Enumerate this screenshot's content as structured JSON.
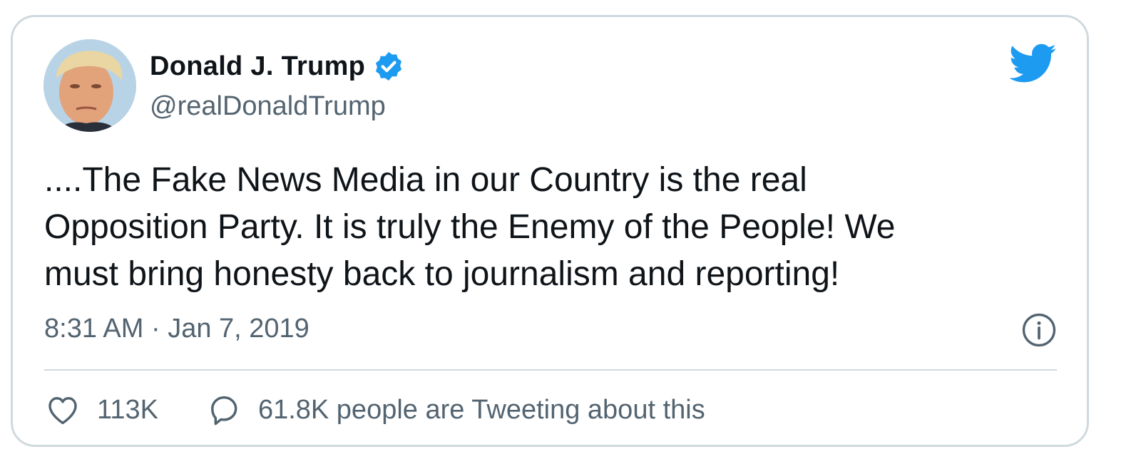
{
  "author": {
    "name": "Donald J. Trump",
    "handle": "@realDonaldTrump",
    "verified": true,
    "avatar_icon": "profile-photo"
  },
  "tweet": {
    "text": "....The Fake News Media in our Country is the real\nOpposition Party. It is truly the Enemy of the People! We\nmust bring honesty back to journalism and reporting!",
    "timestamp": "8:31 AM · Jan 7, 2019"
  },
  "actions": {
    "like_count": "113K",
    "reply_label": "61.8K people are Tweeting about this"
  },
  "icons": {
    "brand": "twitter-bird-icon",
    "verified": "verified-badge-icon",
    "info": "info-icon",
    "like": "heart-icon",
    "reply": "speech-bubble-icon"
  },
  "colors": {
    "brand_blue": "#1d9bf0",
    "text_primary": "#0f1419",
    "text_secondary": "#536471",
    "border": "#cfd9de"
  }
}
